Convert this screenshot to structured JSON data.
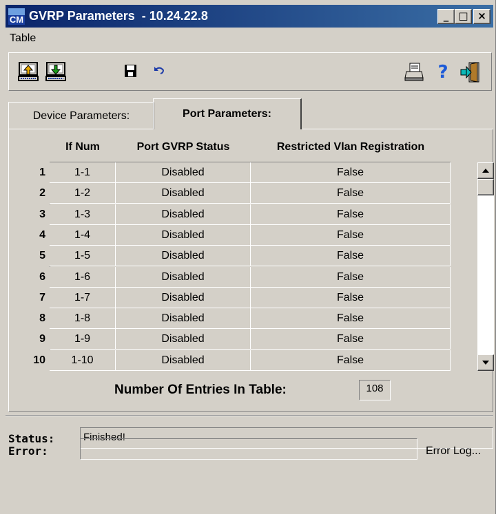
{
  "window": {
    "title": "GVRP Parameters  - 10.24.22.8",
    "app_icon_text": "CM",
    "minimize": "_",
    "maximize": "□",
    "close": "×"
  },
  "menu": {
    "items": [
      "Table"
    ]
  },
  "toolbar": {
    "icons": [
      "upload-icon",
      "download-icon",
      "save-icon",
      "undo-icon",
      "print-icon",
      "help-icon",
      "exit-icon"
    ],
    "help_glyph": "?"
  },
  "tabs": [
    {
      "label": "Device Parameters:",
      "active": false
    },
    {
      "label": "Port Parameters:",
      "active": true
    }
  ],
  "table": {
    "columns": [
      "If Num",
      "Port GVRP Status",
      "Restricted Vlan Registration"
    ],
    "rows": [
      {
        "num": "1",
        "if_num": "1-1",
        "status": "Disabled",
        "restricted": "False"
      },
      {
        "num": "2",
        "if_num": "1-2",
        "status": "Disabled",
        "restricted": "False"
      },
      {
        "num": "3",
        "if_num": "1-3",
        "status": "Disabled",
        "restricted": "False"
      },
      {
        "num": "4",
        "if_num": "1-4",
        "status": "Disabled",
        "restricted": "False"
      },
      {
        "num": "5",
        "if_num": "1-5",
        "status": "Disabled",
        "restricted": "False"
      },
      {
        "num": "6",
        "if_num": "1-6",
        "status": "Disabled",
        "restricted": "False"
      },
      {
        "num": "7",
        "if_num": "1-7",
        "status": "Disabled",
        "restricted": "False"
      },
      {
        "num": "8",
        "if_num": "1-8",
        "status": "Disabled",
        "restricted": "False"
      },
      {
        "num": "9",
        "if_num": "1-9",
        "status": "Disabled",
        "restricted": "False"
      },
      {
        "num": "10",
        "if_num": "1-10",
        "status": "Disabled",
        "restricted": "False"
      }
    ],
    "entries_label": "Number Of Entries In Table:",
    "entries_value": "108"
  },
  "status": {
    "status_label": "Status:",
    "status_value": "Finished!",
    "error_label": "Error:",
    "error_value": "",
    "error_log_label": "Error Log..."
  },
  "colors": {
    "title_start": "#0a246a",
    "title_end": "#3a6ea5",
    "face": "#d4d0c8",
    "help": "#1c5ad8",
    "arrow_up": "#e8a800",
    "arrow_down": "#1a9a1a"
  }
}
